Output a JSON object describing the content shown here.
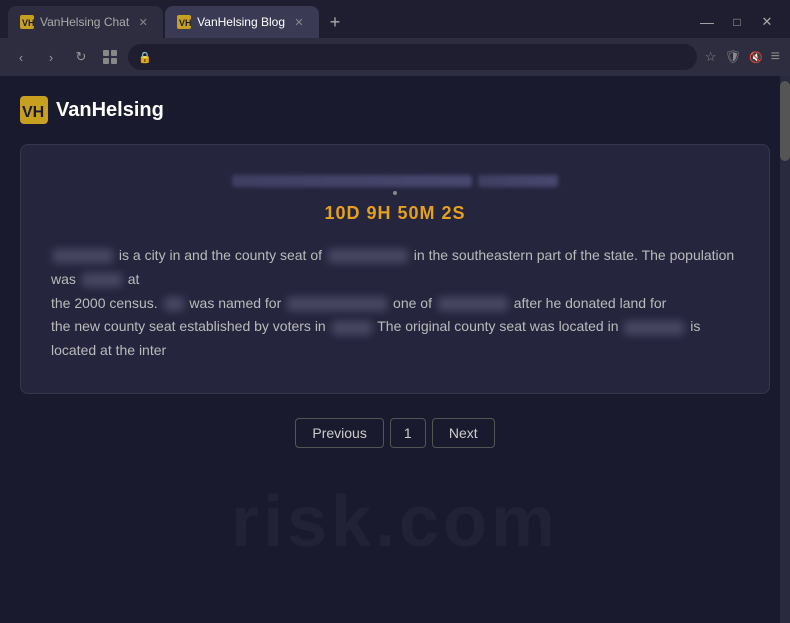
{
  "browser": {
    "tabs": [
      {
        "id": "tab-chat",
        "label": "VanHelsing Chat",
        "active": false,
        "favicon": "VH"
      },
      {
        "id": "tab-blog",
        "label": "VanHelsing Blog",
        "active": true,
        "favicon": "VH"
      }
    ],
    "add_tab_label": "+",
    "nav": {
      "back": "‹",
      "forward": "›",
      "refresh": "↻",
      "extensions": "⚙"
    },
    "address": "",
    "address_icons": {
      "bookmark": "☆",
      "shield": "🛡",
      "settings": "≡"
    }
  },
  "logo": {
    "text": "VanHelsing",
    "icon_label": "VH"
  },
  "card": {
    "title_placeholder": "redacted title",
    "countdown": "10D 9H 50M 2S",
    "article": {
      "line1_before": "is a city in and the county seat of",
      "line1_redacted1": "Decatur",
      "line1_mid": "in the southeastern part of the state. The population was",
      "line1_redacted2": "4,058",
      "line1_after": "at",
      "line2_before": "the 2000 census.",
      "line2_redacted1": "It",
      "line2_mid": "was named for",
      "line2_redacted2": "Stephen Decatur",
      "line2_after": "one of",
      "line2_redacted3": "America's",
      "line2_after2": "after he donated land for",
      "line3_before": "the new county seat established by voters in",
      "line3_redacted1": "1821.",
      "line3_mid": "The original county seat was located in",
      "line3_redacted2": "Albany,",
      "line3_after": "is located at the inter"
    }
  },
  "pagination": {
    "previous_label": "Previous",
    "page_number": "1",
    "next_label": "Next"
  },
  "watermark": {
    "text": "risk.com"
  }
}
